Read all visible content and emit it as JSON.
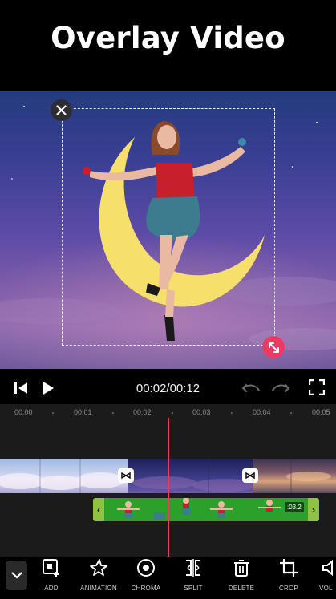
{
  "banner": {
    "title": "Overlay Video"
  },
  "player": {
    "time": "00:02/00:12"
  },
  "ruler": {
    "ticks": [
      "00:00",
      "00:01",
      "00:02",
      "00:03",
      "00:04",
      "00:05"
    ]
  },
  "overlay_clip": {
    "duration": ":03.2"
  },
  "toolbar": {
    "items": [
      {
        "label": "ADD",
        "icon": "add-overlay-icon"
      },
      {
        "label": "ANIMATION",
        "icon": "animation-icon"
      },
      {
        "label": "CHROMA",
        "icon": "chroma-icon"
      },
      {
        "label": "SPLIT",
        "icon": "split-icon"
      },
      {
        "label": "DELETE",
        "icon": "trash-icon"
      },
      {
        "label": "CROP",
        "icon": "crop-icon"
      },
      {
        "label": "VOL",
        "icon": "volume-icon"
      }
    ]
  },
  "colors": {
    "accent": "#ec3b63",
    "playhead": "#ea3d5a",
    "overlay_track": "#8fc240",
    "chroma_green": "#2aa12a"
  }
}
